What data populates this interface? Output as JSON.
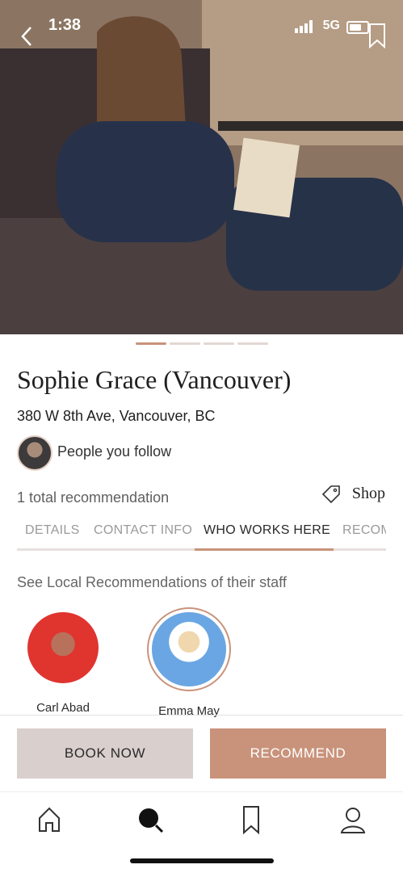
{
  "status_bar": {
    "time": "1:38",
    "network": "5G"
  },
  "profile": {
    "name": "Sophie Grace (Vancouver)",
    "address": "380 W 8th Ave, Vancouver, BC",
    "follow_text": "People you follow",
    "recommendation_count": "1 total recommendation",
    "shop_label": "Shop"
  },
  "carousel": {
    "total": 4,
    "active_index": 0
  },
  "tabs": [
    {
      "label": "DETAILS",
      "active": false
    },
    {
      "label": "CONTACT INFO",
      "active": false
    },
    {
      "label": "WHO WORKS HERE",
      "active": true
    },
    {
      "label": "RECOM",
      "active": false
    }
  ],
  "section": {
    "title": "See Local Recommendations of their staff"
  },
  "staff": [
    {
      "name": "Carl Abad"
    },
    {
      "name": "Emma May"
    }
  ],
  "actions": {
    "book_now": "BOOK NOW",
    "recommend": "RECOMMEND"
  },
  "icons": {
    "back": "chevron-left-icon",
    "bookmark": "bookmark-icon",
    "shop": "tag-icon",
    "nav": [
      "home-icon",
      "search-icon",
      "bookmark-icon",
      "profile-icon"
    ]
  },
  "colors": {
    "accent": "#c9937b",
    "book_button": "#d9cfcd"
  }
}
